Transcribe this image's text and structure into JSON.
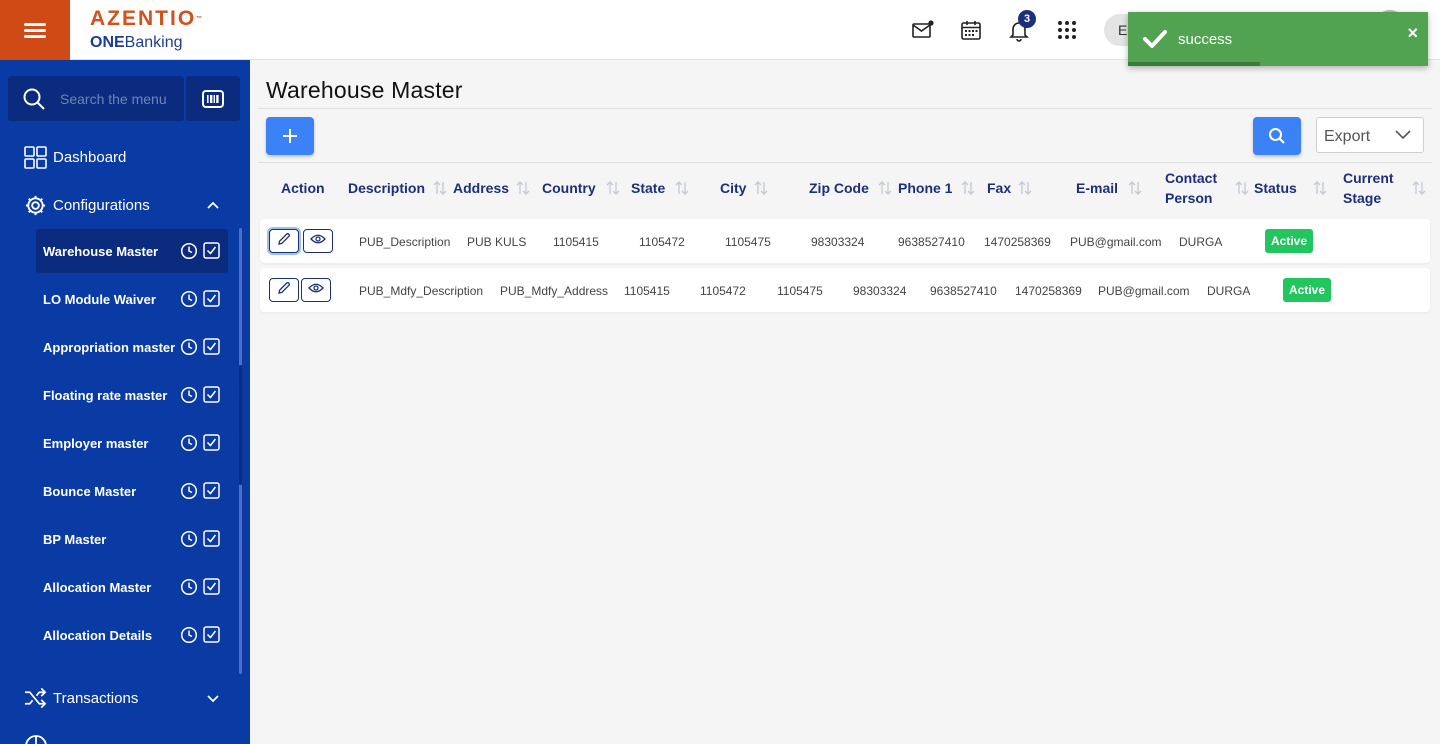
{
  "header": {
    "brand": "AZENTIO",
    "trademark": "™",
    "sub_brand_bold": "ONE",
    "sub_brand_rest": "Banking",
    "notification_count": "3",
    "user_initial": "E",
    "icons": [
      "menu-icon",
      "mail-icon",
      "calendar-icon",
      "bell-icon",
      "apps-grid-icon"
    ]
  },
  "toast": {
    "message": "success",
    "close": "×",
    "progress": 0.44
  },
  "sidebar": {
    "search_placeholder": "Search the menu",
    "dashboard": "Dashboard",
    "configurations": "Configurations",
    "items": [
      {
        "label": "Warehouse Master"
      },
      {
        "label": "LO Module Waiver"
      },
      {
        "label": "Appropriation master"
      },
      {
        "label": "Floating rate master"
      },
      {
        "label": "Employer master"
      },
      {
        "label": "Bounce Master"
      },
      {
        "label": "BP Master"
      },
      {
        "label": "Allocation Master"
      },
      {
        "label": "Allocation Details"
      }
    ],
    "transactions": "Transactions"
  },
  "main": {
    "title": "Warehouse Master",
    "export_label": "Export",
    "columns": {
      "action": "Action",
      "description": "Description",
      "address": "Address",
      "country": "Country",
      "state": "State",
      "city": "City",
      "zip": "Zip Code",
      "phone1": "Phone 1",
      "fax": "Fax",
      "email": "E-mail",
      "contact_l1": "Contact",
      "contact_l2": "Person",
      "status": "Status",
      "stage_l1": "Current",
      "stage_l2": "Stage"
    },
    "rows": [
      {
        "description": "PUB_Description",
        "address": "PUB KULS",
        "country": "1105415",
        "state": "1105472",
        "city": "1105475",
        "zip": "98303324",
        "phone1": "9638527410",
        "fax": "1470258369",
        "email": "PUB@gmail.com",
        "contact": "DURGA",
        "status": "Active",
        "stage": ""
      },
      {
        "description": "PUB_Mdfy_Description",
        "address": "PUB_Mdfy_Address",
        "country": "1105415",
        "state": "1105472",
        "city": "1105475",
        "zip": "98303324",
        "phone1": "9638527410",
        "fax": "1470258369",
        "email": "PUB@gmail.com",
        "contact": "DURGA",
        "status": "Active",
        "stage": ""
      }
    ]
  },
  "colors": {
    "brand_orange": "#cf4a14",
    "sidebar_blue": "#0a3aa3",
    "primary_button": "#3b82f6",
    "header_text": "#1c2f7c",
    "toast_green": "#51a351",
    "active_badge": "#22c55e"
  }
}
